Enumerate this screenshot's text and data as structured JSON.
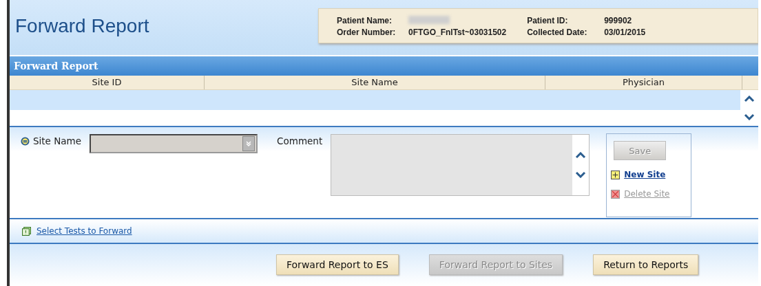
{
  "page_title": "Forward Report",
  "patient": {
    "name_label": "Patient Name:",
    "order_label": "Order Number:",
    "order_value": "0FTGO_FnlTst~03031502",
    "id_label": "Patient ID:",
    "id_value": "999902",
    "date_label": "Collected Date:",
    "date_value": "03/01/2015"
  },
  "panel_title": "Forward Report",
  "table": {
    "columns": [
      "Site ID",
      "Site Name",
      "Physician"
    ]
  },
  "form": {
    "site_label": "Site Name",
    "comment_label": "Comment",
    "save": {
      "label": "Save",
      "disabled": true
    },
    "actions": [
      {
        "label": "New Site",
        "disabled": false,
        "kind": "add"
      },
      {
        "label": "Delete Site",
        "disabled": true,
        "kind": "delete"
      }
    ]
  },
  "select_tests_link": "Select Tests to Forward",
  "buttons": [
    {
      "label": "Forward Report to ES",
      "disabled": false
    },
    {
      "label": "Forward Report to Sites",
      "disabled": true
    },
    {
      "label": "Return to Reports",
      "disabled": false
    }
  ]
}
